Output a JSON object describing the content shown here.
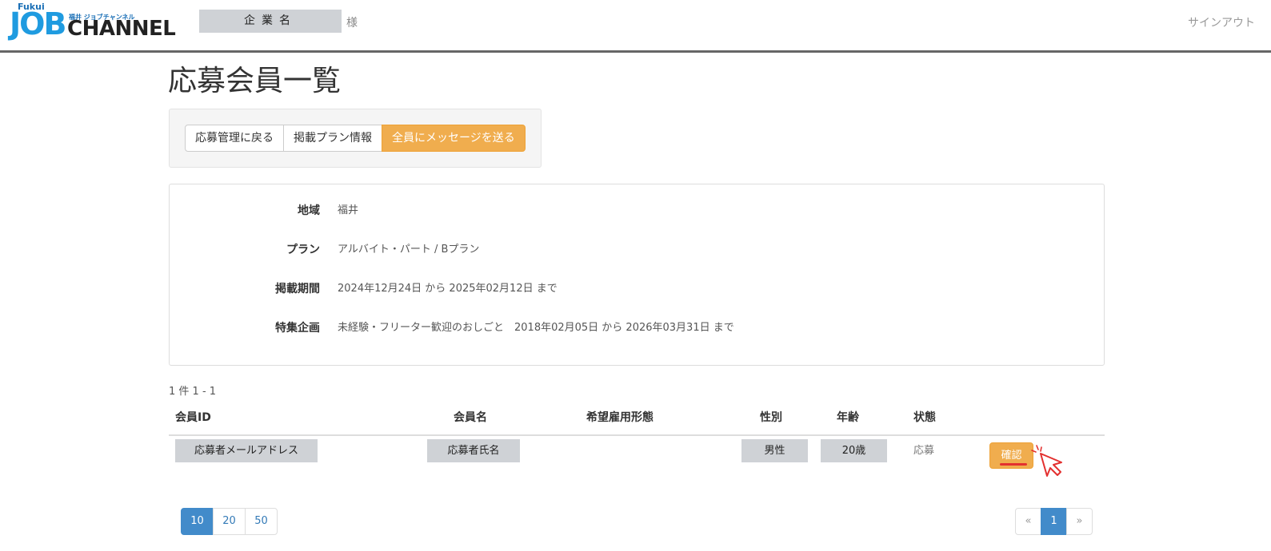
{
  "header": {
    "logo": {
      "fukui": "Fukui",
      "job": "JOB",
      "channel": "CHANNEL",
      "sub": "福井 ジョブチャンネル"
    },
    "company_name": "企業名",
    "company_suffix": "様",
    "signout": "サインアウト"
  },
  "page_title": "応募会員一覧",
  "toolbar": {
    "back_label": "応募管理に戻る",
    "plan_info_label": "掲載プラン情報",
    "message_all_label": "全員にメッセージを送る"
  },
  "info": {
    "region": {
      "label": "地域",
      "value": "福井"
    },
    "plan": {
      "label": "プラン",
      "value": "アルバイト・パート / Bプラン"
    },
    "period": {
      "label": "掲載期間",
      "value": "2024年12月24日 から 2025年02月12日 まで"
    },
    "feature": {
      "label": "特集企画",
      "value": "未経験・フリーター歓迎のおしごと　2018年02月05日 から 2026年03月31日 まで"
    }
  },
  "result_count": "1 件 1 - 1",
  "table": {
    "headers": {
      "member_id": "会員ID",
      "member_name": "会員名",
      "employment_type": "希望雇用形態",
      "gender": "性別",
      "age": "年齢",
      "status": "状態"
    },
    "rows": [
      {
        "member_id": "応募者メールアドレス",
        "member_name": "応募者氏名",
        "employment_type": "",
        "gender": "男性",
        "age": "20歳",
        "status": "応募",
        "action": "確認"
      }
    ]
  },
  "page_size": {
    "options": [
      "10",
      "20",
      "50"
    ],
    "selected": "10"
  },
  "pagination": {
    "prev": "«",
    "current": "1",
    "next": "»"
  },
  "colors": {
    "accent": "#f0ad4e",
    "primary": "#428bca",
    "link": "#337ab7",
    "highlight": "#e3302f"
  }
}
